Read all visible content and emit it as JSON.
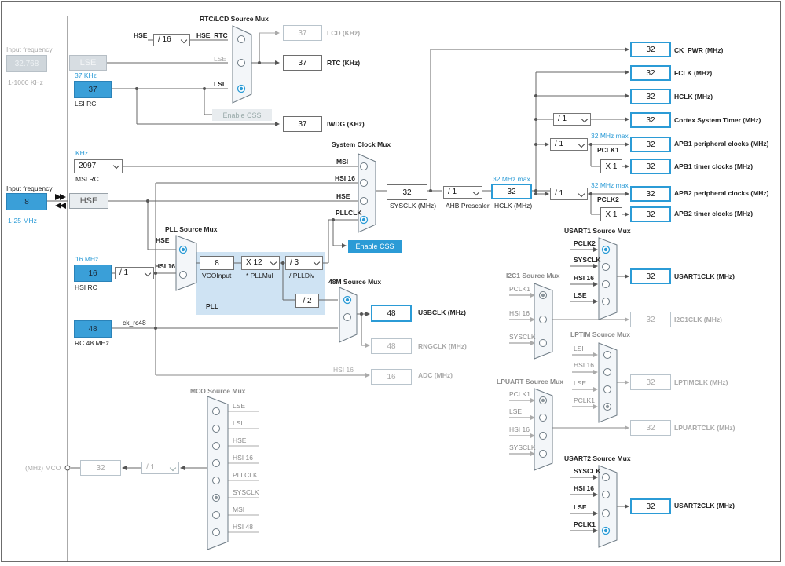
{
  "title_mux": {
    "rtc_lcd": "RTC/LCD Source Mux",
    "system_clock": "System Clock Mux",
    "pll_source": "PLL Source Mux",
    "usb48": "48M Source Mux",
    "mco": "MCO Source Mux",
    "usart1": "USART1 Source Mux",
    "i2c1": "I2C1 Source Mux",
    "lptim": "LPTIM Source Mux",
    "lpuart": "LPUART Source Mux",
    "usart2": "USART2 Source Mux"
  },
  "lse": {
    "input_label": "Input frequency",
    "input_value": "32.768",
    "range": "1-1000 KHz",
    "name": "LSE"
  },
  "lsi": {
    "freq_label": "37 KHz",
    "value": "37",
    "name": "LSI RC"
  },
  "msi": {
    "unit": "KHz",
    "value": "2097",
    "name": "MSI RC"
  },
  "hse": {
    "input_label": "Input frequency",
    "input_value": "8",
    "range": "1-25 MHz",
    "name": "HSE"
  },
  "hsi": {
    "freq_label": "16 MHz",
    "value": "16",
    "name": "HSI RC",
    "div": "/ 1"
  },
  "rc48": {
    "value": "48",
    "name": "RC 48 MHz",
    "wire_label": "ck_rc48"
  },
  "rtc_mux": {
    "hse_label": "HSE",
    "div": "/ 16",
    "hse_rtc": "HSE_RTC",
    "lse": "LSE",
    "lsi": "LSI",
    "enable_css": "Enable CSS"
  },
  "outputs_left": {
    "lcd": {
      "value": "37",
      "label": "LCD (KHz)"
    },
    "rtc": {
      "value": "37",
      "label": "RTC (KHz)"
    },
    "iwdg": {
      "value": "37",
      "label": "IWDG (KHz)"
    }
  },
  "sysmux": {
    "msi": "MSI",
    "hsi16": "HSI 16",
    "hse": "HSE",
    "pllclk": "PLLCLK",
    "enable_css": "Enable CSS"
  },
  "pll": {
    "hse": "HSE",
    "hsi16": "HSI 16",
    "vco_value": "8",
    "vco_label": "VCOInput",
    "mul": "X 12",
    "mul_label": "* PLLMul",
    "div": "/ 3",
    "div_label": "/ PLLDiv",
    "name": "PLL",
    "usb_div": "/ 2"
  },
  "sysclk": {
    "value": "32",
    "label": "SYSCLK (MHz)"
  },
  "ahb": {
    "div": "/ 1",
    "label": "AHB Prescaler"
  },
  "hclk": {
    "max": "32 MHz max",
    "value": "32",
    "label": "HCLK (MHz)"
  },
  "right_outputs": {
    "ck_pwr": {
      "value": "32",
      "label": "CK_PWR (MHz)"
    },
    "fclk": {
      "value": "32",
      "label": "FCLK (MHz)"
    },
    "hclk": {
      "value": "32",
      "label": "HCLK (MHz)"
    },
    "cortex": {
      "div": "/ 1",
      "value": "32",
      "label": "Cortex System Timer (MHz)"
    },
    "apb1": {
      "div": "/ 1",
      "max": "32 MHz max",
      "pclk": "PCLK1",
      "value": "32",
      "label": "APB1 peripheral clocks (MHz)"
    },
    "apb1_timer": {
      "mul": "X 1",
      "value": "32",
      "label": "APB1 timer clocks (MHz)"
    },
    "apb2": {
      "div": "/ 1",
      "max": "32 MHz max",
      "pclk": "PCLK2",
      "value": "32",
      "label": "APB2 peripheral clocks (MHz)"
    },
    "apb2_timer": {
      "mul": "X 1",
      "value": "32",
      "label": "APB2 timer clocks (MHz)"
    }
  },
  "usb": {
    "usbclk": {
      "value": "48",
      "label": "USBCLK (MHz)"
    },
    "rngclk": {
      "value": "48",
      "label": "RNGCLK (MHz)"
    }
  },
  "adc": {
    "label_in": "HSI 16",
    "value": "16",
    "label": "ADC (MHz)"
  },
  "mco": {
    "inputs": [
      "LSE",
      "LSI",
      "HSE",
      "HSI 16",
      "PLLCLK",
      "SYSCLK",
      "MSI",
      "HSI 48"
    ],
    "div": "/ 1",
    "value": "32",
    "label": "(MHz) MCO"
  },
  "usart1": {
    "inputs": [
      "PCLK2",
      "SYSCLK",
      "HSI 16",
      "LSE"
    ],
    "value": "32",
    "label": "USART1CLK (MHz)"
  },
  "i2c1": {
    "inputs": [
      "PCLK1",
      "HSI 16",
      "SYSCLK"
    ],
    "value": "32",
    "label": "I2C1CLK (MHz)"
  },
  "lptim": {
    "inputs": [
      "LSI",
      "HSI 16",
      "LSE",
      "PCLK1"
    ],
    "value": "32",
    "label": "LPTIMCLK (MHz)"
  },
  "lpuart": {
    "inputs": [
      "PCLK1",
      "LSE",
      "HSI 16",
      "SYSCLK"
    ],
    "value": "32",
    "label": "LPUARTCLK (MHz)"
  },
  "usart2": {
    "inputs": [
      "SYSCLK",
      "HSI 16",
      "LSE",
      "PCLK1"
    ],
    "value": "32",
    "label": "USART2CLK (MHz)"
  },
  "colors": {
    "accent": "#2b9bd6",
    "grey_box": "#b9c4cc",
    "pll_bg": "#cfe3f3"
  }
}
